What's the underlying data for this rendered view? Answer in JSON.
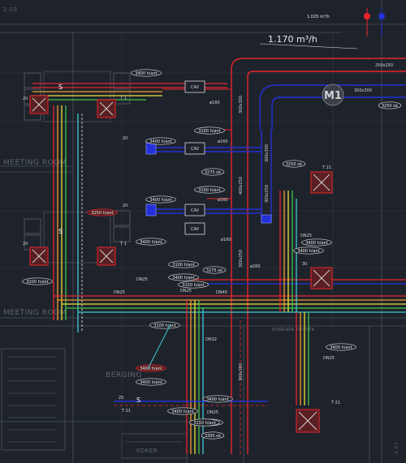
{
  "drawing": {
    "top_flow": "1.170 m³/h",
    "top_flow_small": "1.025 m³/h",
    "room_code": "2.03",
    "room_code_right": "2.07",
    "shaft_label": "M1",
    "rooms": {
      "meeting_1": "MEETING ROOM",
      "meeting_2": "MEETING ROOM",
      "berging": "BERGING",
      "koker": "KOKER",
      "mobile": "mobiele ruimte"
    },
    "cav_label": "CAV",
    "sizes": {
      "s250x250": "250x250",
      "s300x300_a": "300x300",
      "s300x300_b": "300x300",
      "s300x250": "300x250",
      "s400x250": "400x250",
      "s300x300_v": "300x300",
      "s300x250_v": "300x250",
      "s350x300": "300x300"
    },
    "tags": {
      "t3400_top": "3400 h/ant",
      "t3100_a": "3100 h/ant",
      "t3400_a": "3400 h/ant",
      "t3275": "3275 ok",
      "t3100_b": "3100 h/ant",
      "t3400_b": "3400 h/ant",
      "t3250_right": "3250 ok",
      "t3250_top": "3250 ok",
      "t3250_red": "3250 h/ant",
      "t3400_c": "3400 h/ant",
      "t3400_d": "3400 h/ant",
      "t3100_c": "3100 h/ant",
      "t3275_b": "3275 ok",
      "t3150": "3150 h/ant",
      "t3200_left": "3200 h/ant",
      "t3400_e": "3400 h/ant",
      "t3400_f": "3400 h/ant",
      "t3400_g": "3400 h/ant",
      "t3100_d": "3100 h/ant",
      "t3400_h": "3400 h/ant",
      "t3400_i": "3400 h/ant",
      "t3100_e": "3100 h/ant",
      "t3150_b": "3150 h/ant",
      "t3300": "3300 ok",
      "t3400_red": "3400 h/ant",
      "t3400_bottom": "3400 h/ant"
    },
    "duct_labels": {
      "dn25_a": "DN25",
      "dn25_b": "DN25",
      "dn25_c": "DN25",
      "dn40": "DN40",
      "dn32": "DN32",
      "dn25_d": "DN25",
      "dn25_e": "DN25",
      "dn25_f": "DN25"
    },
    "unit_labels": {
      "t1_a": "T 1",
      "t1_b": "T 1",
      "t21_a": "T 21",
      "t21_b": "T 21",
      "t21_c": "T 21",
      "n2ii_a": "2II",
      "n2ii_b": "2II",
      "n2ii_c": "2II",
      "n2ii_d": "2II",
      "n3ii": "3II",
      "n2s": "2S",
      "s_a": "S",
      "s_b": "S",
      "s_c": "S",
      "o160_a": "ø160",
      "o160_b": "ø160",
      "o160_c": "ø160",
      "o160_d": "ø160",
      "o200": "ø200"
    }
  },
  "colors": {
    "background": "#1e232b",
    "supply_red": "#e8242c",
    "return_blue": "#2430d8",
    "hot_orange": "#f19a2a",
    "yellow": "#e8e03a",
    "green": "#3fc44a",
    "cyan": "#3fc9d6",
    "white": "#e9e9e9",
    "grid": "#3a414c"
  }
}
